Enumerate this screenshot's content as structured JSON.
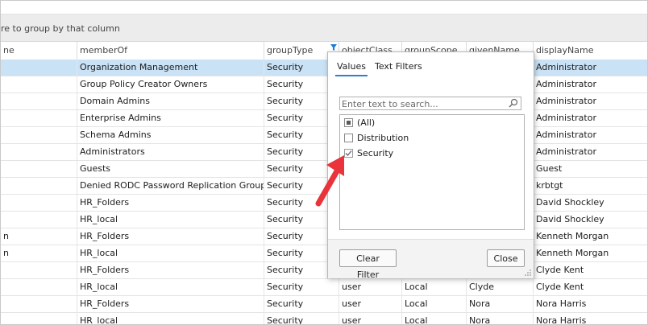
{
  "group_panel": {
    "hint": "re to group by that column"
  },
  "columns": [
    "ne",
    "memberOf",
    "groupType",
    "objectClass",
    "groupScope",
    "givenName",
    "displayName"
  ],
  "rows": [
    {
      "c0": "",
      "memberOf": "Organization Management",
      "groupType": "Security",
      "objectClass": "",
      "groupScope": "",
      "givenName": "",
      "displayName": "Administrator"
    },
    {
      "c0": "",
      "memberOf": "Group Policy Creator Owners",
      "groupType": "Security",
      "objectClass": "",
      "groupScope": "",
      "givenName": "",
      "displayName": "Administrator"
    },
    {
      "c0": "",
      "memberOf": "Domain Admins",
      "groupType": "Security",
      "objectClass": "",
      "groupScope": "",
      "givenName": "",
      "displayName": "Administrator"
    },
    {
      "c0": "",
      "memberOf": "Enterprise Admins",
      "groupType": "Security",
      "objectClass": "",
      "groupScope": "",
      "givenName": "",
      "displayName": "Administrator"
    },
    {
      "c0": "",
      "memberOf": "Schema Admins",
      "groupType": "Security",
      "objectClass": "",
      "groupScope": "",
      "givenName": "",
      "displayName": "Administrator"
    },
    {
      "c0": "",
      "memberOf": "Administrators",
      "groupType": "Security",
      "objectClass": "",
      "groupScope": "",
      "givenName": "",
      "displayName": "Administrator"
    },
    {
      "c0": "",
      "memberOf": "Guests",
      "groupType": "Security",
      "objectClass": "",
      "groupScope": "",
      "givenName": "",
      "displayName": "Guest"
    },
    {
      "c0": "",
      "memberOf": "Denied RODC Password Replication Group",
      "groupType": "Security",
      "objectClass": "",
      "groupScope": "",
      "givenName": "",
      "displayName": "krbtgt"
    },
    {
      "c0": "",
      "memberOf": "HR_Folders",
      "groupType": "Security",
      "objectClass": "",
      "groupScope": "",
      "givenName": "",
      "displayName": "David Shockley"
    },
    {
      "c0": "",
      "memberOf": "HR_local",
      "groupType": "Security",
      "objectClass": "",
      "groupScope": "",
      "givenName": "",
      "displayName": "David Shockley"
    },
    {
      "c0": "n",
      "memberOf": "HR_Folders",
      "groupType": "Security",
      "objectClass": "",
      "groupScope": "",
      "givenName": "",
      "displayName": "Kenneth Morgan"
    },
    {
      "c0": "n",
      "memberOf": "HR_local",
      "groupType": "Security",
      "objectClass": "",
      "groupScope": "",
      "givenName": "",
      "displayName": "Kenneth Morgan"
    },
    {
      "c0": "",
      "memberOf": "HR_Folders",
      "groupType": "Security",
      "objectClass": "",
      "groupScope": "",
      "givenName": "",
      "displayName": "Clyde Kent"
    },
    {
      "c0": "",
      "memberOf": "HR_local",
      "groupType": "Security",
      "objectClass": "user",
      "groupScope": "Local",
      "givenName": "Clyde",
      "displayName": "Clyde Kent"
    },
    {
      "c0": "",
      "memberOf": "HR_Folders",
      "groupType": "Security",
      "objectClass": "user",
      "groupScope": "Local",
      "givenName": "Nora",
      "displayName": "Nora Harris"
    },
    {
      "c0": "",
      "memberOf": "HR_local",
      "groupType": "Security",
      "objectClass": "user",
      "groupScope": "Local",
      "givenName": "Nora",
      "displayName": "Nora Harris"
    }
  ],
  "filter_popup": {
    "tabs": [
      "Values",
      "Text Filters"
    ],
    "active_tab": "Values",
    "search_placeholder": "Enter text to search...",
    "values": [
      {
        "label": "(All)",
        "state": "indeterminate"
      },
      {
        "label": "Distribution",
        "state": "unchecked"
      },
      {
        "label": "Security",
        "state": "checked"
      }
    ],
    "clear_label": "Clear Filter",
    "close_label": "Close"
  },
  "colors": {
    "selected_row": "#c9e2f6",
    "accent": "#2b7fd6",
    "arrow": "#e8343a"
  }
}
